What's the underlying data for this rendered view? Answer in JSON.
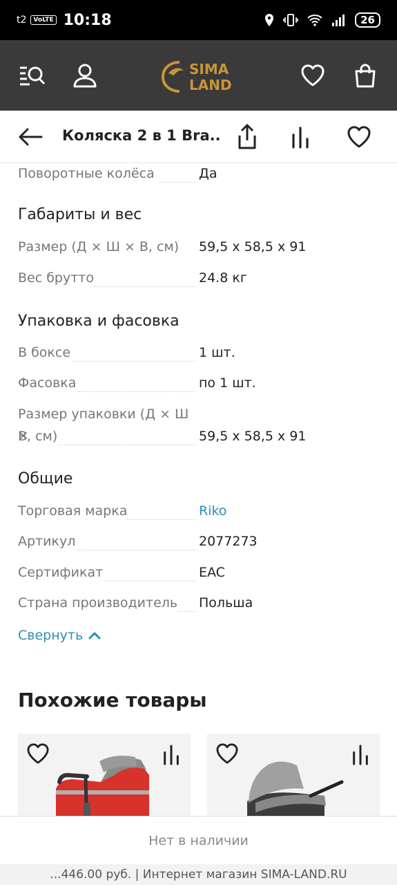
{
  "status_bar": {
    "carrier": "t2",
    "volte": "VoLTE",
    "time": "10:18",
    "battery": "26"
  },
  "header": {
    "logo_line1": "SIMA",
    "logo_line2": "LAND",
    "brand_color": "#c9943a",
    "icons": [
      "catalog-search-icon",
      "user-icon",
      "heart-icon",
      "bag-icon"
    ]
  },
  "toolbar": {
    "title": "Коляска 2 в 1 Bra..."
  },
  "specs": {
    "top_row": {
      "label": "Поворотные колёса",
      "value": "Да"
    },
    "sections": [
      {
        "title": "Габариты и вес",
        "rows": [
          {
            "label": "Размер (Д × Ш × В, см)",
            "value": "59,5 х 58,5 х 91"
          },
          {
            "label": "Вес брутто",
            "value": "24.8 кг"
          }
        ]
      },
      {
        "title": "Упаковка и фасовка",
        "rows": [
          {
            "label": "В боксе",
            "value": "1 шт."
          },
          {
            "label": "Фасовка",
            "value": "по 1 шт."
          },
          {
            "label": "Размер упаковки (Д × Ш ×",
            "label2": "В, см)",
            "value": "59,5 х 58,5 х 91"
          }
        ]
      },
      {
        "title": "Общие",
        "rows": [
          {
            "label": "Торговая марка",
            "value": "Riko"
          },
          {
            "label": "Артикул",
            "value": "2077273"
          },
          {
            "label": "Сертификат",
            "value": "EAC"
          },
          {
            "label": "Страна производитель",
            "value": "Польша"
          }
        ]
      }
    ],
    "collapse_label": "Свернуть"
  },
  "similar": {
    "title": "Похожие товары"
  },
  "availability": "Нет в наличии",
  "footer_text": "...446.00 руб. | Интернет магазин SIMA-LAND.RU",
  "colors": {
    "link": "#2a8fb8",
    "header_bg": "#3a3a3a"
  }
}
